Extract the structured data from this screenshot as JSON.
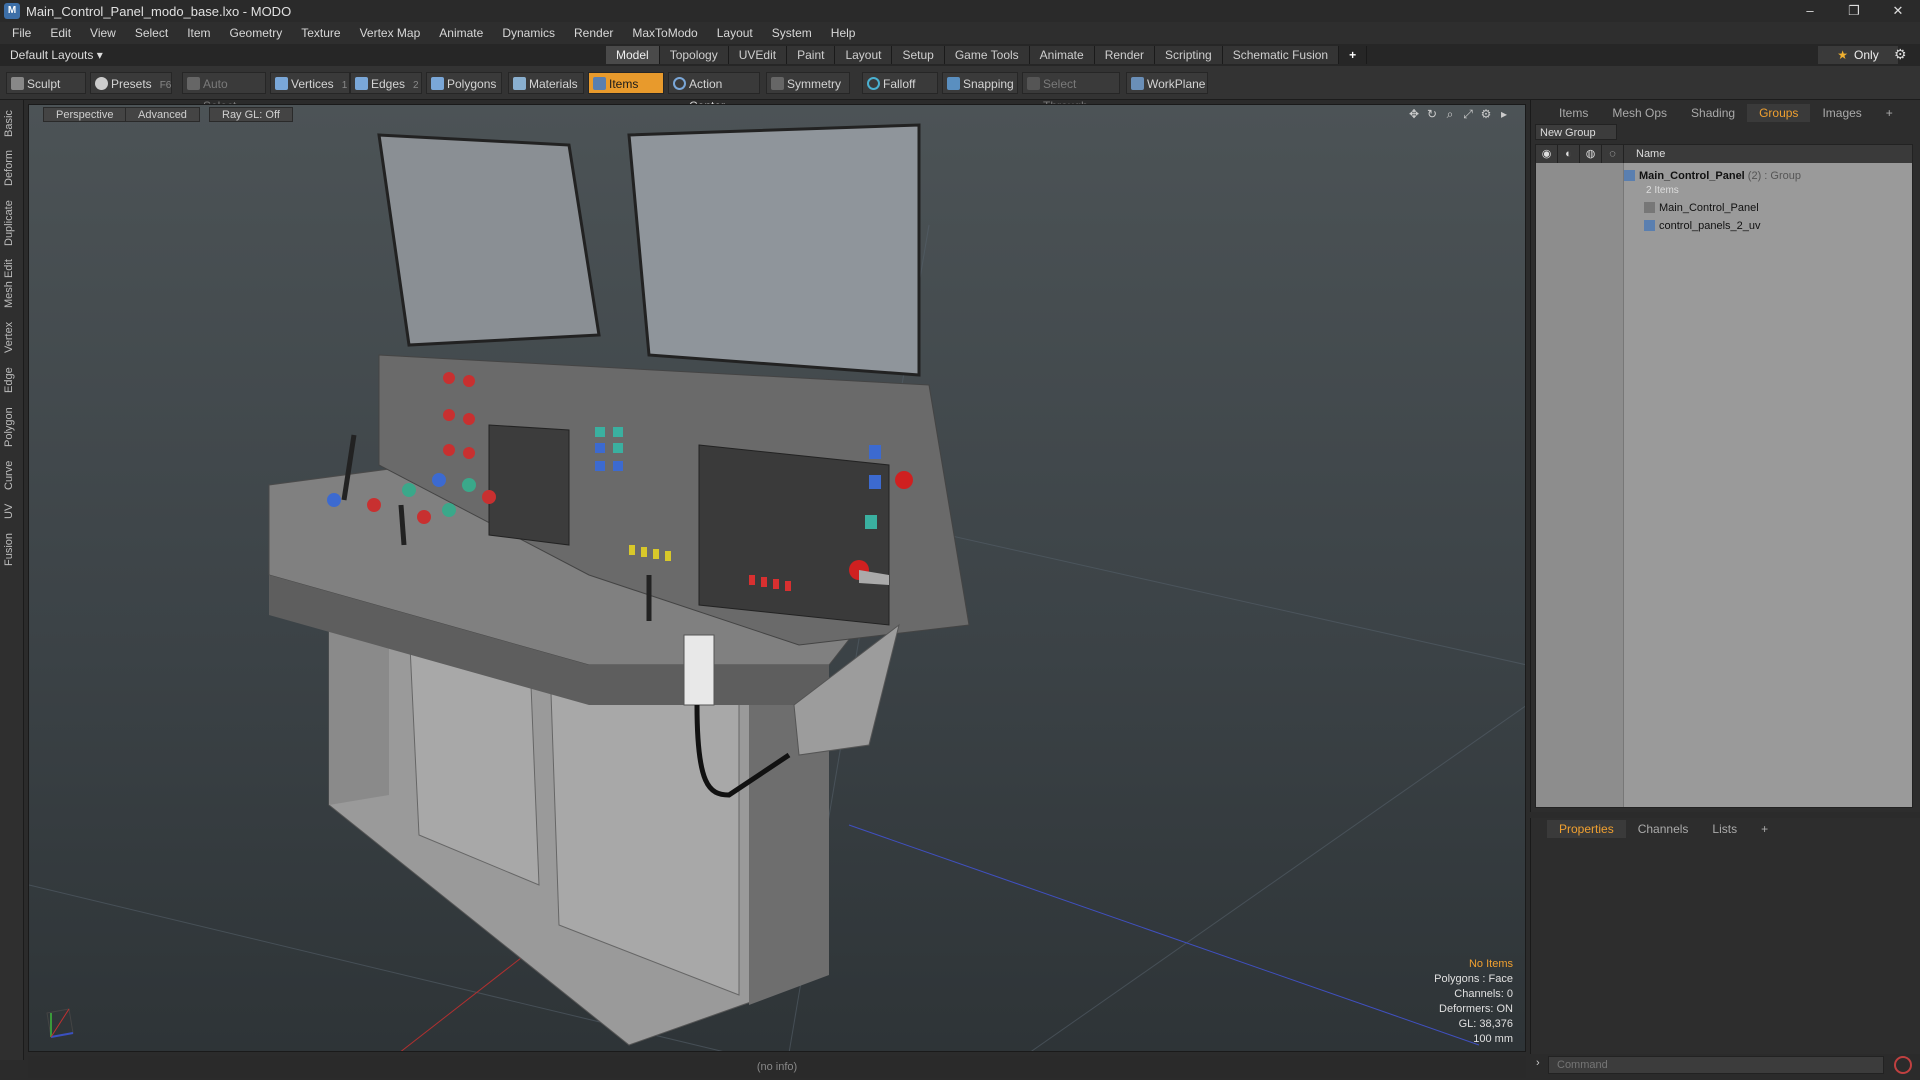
{
  "window": {
    "title": "Main_Control_Panel_modo_base.lxo - MODO",
    "minimize": "–",
    "maximize": "❐",
    "close": "✕"
  },
  "menu": [
    "File",
    "Edit",
    "View",
    "Select",
    "Item",
    "Geometry",
    "Texture",
    "Vertex Map",
    "Animate",
    "Dynamics",
    "Render",
    "MaxToModo",
    "Layout",
    "System",
    "Help"
  ],
  "layoutbar": {
    "layout_selector": "Default Layouts ▾",
    "tabs": [
      "Model",
      "Topology",
      "UVEdit",
      "Paint",
      "Layout",
      "Setup",
      "Game Tools",
      "Animate",
      "Render",
      "Scripting",
      "Schematic Fusion"
    ],
    "active_tab": "Model",
    "add": "+",
    "only_label": "Only"
  },
  "toolbar": {
    "sculpt": "Sculpt",
    "presets": "Presets",
    "presets_key": "F6",
    "auto_select": "Auto Select",
    "vertices": "Vertices",
    "vertices_key": "1",
    "edges": "Edges",
    "edges_key": "2",
    "polygons": "Polygons",
    "materials": "Materials",
    "items": "Items",
    "action_center": "Action Center",
    "symmetry": "Symmetry",
    "falloff": "Falloff",
    "snapping": "Snapping",
    "select_through": "Select Through",
    "workplane": "WorkPlane"
  },
  "left_strip": [
    "Basic",
    "Deform",
    "Duplicate",
    "Mesh Edit",
    "Vertex",
    "Edge",
    "Polygon",
    "Curve",
    "UV",
    "Fusion"
  ],
  "viewport": {
    "view": "Perspective",
    "shading": "Advanced",
    "raygl": "Ray GL: Off",
    "info": {
      "selection": "No Items",
      "polygons": "Polygons : Face",
      "channels": "Channels: 0",
      "deformers": "Deformers: ON",
      "gl": "GL: 38,376",
      "scale": "100 mm"
    }
  },
  "right_panel": {
    "tabs": [
      "Items",
      "Mesh Ops",
      "Shading",
      "Groups",
      "Images"
    ],
    "active_tab": "Groups",
    "new_group": "New Group",
    "name_header": "Name",
    "group_name": "Main_Control_Panel",
    "group_meta": " (2) : Group",
    "group_count": "2 Items",
    "children": [
      "Main_Control_Panel",
      "control_panels_2_uv"
    ]
  },
  "properties_panel": {
    "tabs": [
      "Properties",
      "Channels",
      "Lists"
    ],
    "active_tab": "Properties"
  },
  "status": {
    "info": "(no info)",
    "command_placeholder": "Command"
  },
  "colors": {
    "accent": "#e89a2c",
    "viewport_top": "#4c5356",
    "viewport_bottom": "#2e3437"
  }
}
